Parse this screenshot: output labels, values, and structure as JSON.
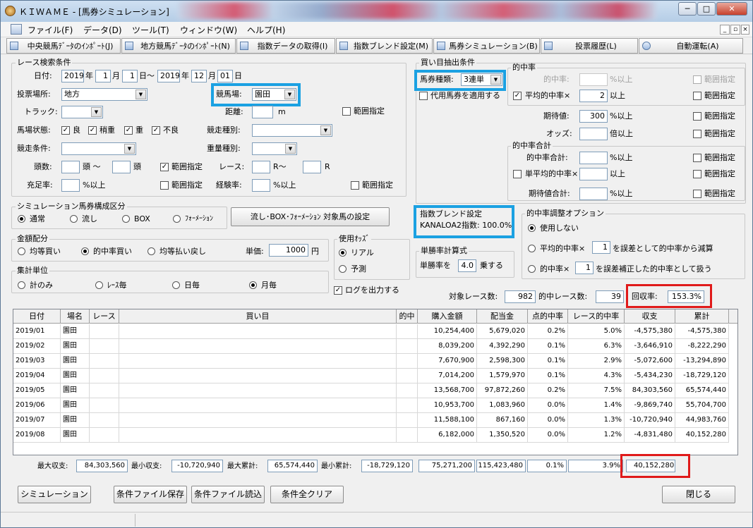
{
  "window": {
    "title": "ＫＩＷＡＭＥ - [馬券シミュレーション]",
    "minimize": "─",
    "maximize": "□",
    "close": "✕"
  },
  "menu": {
    "items": [
      "ファイル(F)",
      "データ(D)",
      "ツール(T)",
      "ウィンドウ(W)",
      "ヘルプ(H)"
    ],
    "mdi_min": "_",
    "mdi_restore": "▫",
    "mdi_close": "×"
  },
  "toolbar": {
    "items": [
      "中央競馬ﾃﾞｰﾀのｲﾝﾎﾟｰﾄ(J)",
      "地方競馬ﾃﾞｰﾀのｲﾝﾎﾟｰﾄ(N)",
      "指数データの取得(I)",
      "指数ブレンド設定(M)",
      "馬券シミュレーション(B)",
      "投票履歴(L)",
      "自動運転(A)"
    ]
  },
  "race_search": {
    "title": "レース検索条件",
    "date_label": "日付:",
    "from_year": "2019",
    "year_unit": "年",
    "from_month": "1",
    "month_unit": "月",
    "from_day": "1",
    "day_range": "日〜",
    "to_year": "2019",
    "to_month": "12",
    "to_day": "01",
    "day_unit": "日",
    "venue_label": "投票場所:",
    "venue_value": "地方",
    "track_name_label": "競馬場:",
    "track_name_value": "園田",
    "track_label": "トラック:",
    "track_value": "",
    "distance_label": "距離:",
    "distance_value": "",
    "distance_unit": "m",
    "range_label": "範囲指定",
    "condition_label": "馬場状態:",
    "conditions": [
      "良",
      "稍重",
      "重",
      "不良"
    ],
    "race_type_label": "競走種別:",
    "race_type_value": "",
    "race_cond_label": "競走条件:",
    "race_cond_value": "",
    "weight_label": "重量種別:",
    "weight_value": "",
    "heads_label": "頭数:",
    "heads_unit1": "頭 〜",
    "heads_unit2": "頭",
    "heads_range": "範囲指定",
    "race_label": "レース:",
    "race_unit1": "R〜",
    "race_unit2": "R",
    "fill_label": "充足率:",
    "fill_unit": "%以上",
    "fill_range": "範囲指定",
    "exp_label": "経験率:",
    "exp_unit": "%以上",
    "exp_range": "範囲指定"
  },
  "sim_type": {
    "title": "シミュレーション馬券構成区分",
    "options": [
      "通常",
      "流し",
      "BOX",
      "ﾌｫｰﾒｰｼｮﾝ"
    ],
    "selected": 0,
    "set_button": "流し･BOX･ﾌｫｰﾒｰｼｮﾝ 対象馬の設定"
  },
  "money": {
    "title": "金額配分",
    "options": [
      "均等買い",
      "的中率買い",
      "均等払い戻し"
    ],
    "selected": 1,
    "unit_label": "単価:",
    "unit_value": "1000",
    "unit_yen": "円"
  },
  "odds": {
    "title": "使用ｵｯｽﾞ",
    "options": [
      "リアル",
      "予測"
    ],
    "selected": 0
  },
  "aggregate": {
    "title": "集計単位",
    "options": [
      "計のみ",
      "ﾚｰｽ毎",
      "日毎",
      "月毎"
    ],
    "selected": 3
  },
  "log_label": "ログを出力する",
  "bet_extract": {
    "title": "買い目抽出条件",
    "ticket_label": "馬券種類:",
    "ticket_value": "3連単",
    "substitute_label": "代用馬券を適用する"
  },
  "hit_rate": {
    "title": "的中率",
    "rows": [
      {
        "label": "的中率:",
        "value": "",
        "unit": "%以上",
        "checked": false,
        "disabled": true
      },
      {
        "label": "平均的中率×",
        "value": "2",
        "unit": "以上",
        "checked": true
      },
      {
        "label": "期待値:",
        "value": "300",
        "unit": "%以上"
      },
      {
        "label": "オッズ:",
        "value": "",
        "unit": "倍以上"
      }
    ],
    "range_label": "範囲指定"
  },
  "hit_total": {
    "title": "的中率合計",
    "rows": [
      {
        "label": "的中率合計:",
        "value": "",
        "unit": "%以上"
      },
      {
        "label": "単平均的中率×",
        "value": "",
        "unit": "以上"
      },
      {
        "label": "期待値合計:",
        "value": "",
        "unit": "%以上"
      }
    ]
  },
  "blend": {
    "title": "指数ブレンド設定",
    "value": "KANALOA2指数: 100.0%"
  },
  "single_calc": {
    "title": "単勝率計算式",
    "label": "単勝率を",
    "value": "4.0",
    "unit": "乗する"
  },
  "adjust": {
    "title": "的中率調整オプション",
    "opt1": "使用しない",
    "opt2_pre": "平均的中率×",
    "opt2_val": "1",
    "opt2_post": "を誤差として的中率から減算",
    "opt3_pre": "的中率×",
    "opt3_val": "1",
    "opt3_post": "を誤差補正した的中率として扱う",
    "selected": 0
  },
  "summary": {
    "target_label": "対象レース数:",
    "target_value": "982",
    "hit_label": "的中レース数:",
    "hit_value": "39",
    "recovery_label": "回収率:",
    "recovery_value": "153.3%"
  },
  "table": {
    "headers": [
      "日付",
      "場名",
      "レース",
      "買い目",
      "的中",
      "購入金額",
      "配当金",
      "点的中率",
      "レース的中率",
      "収支",
      "累計"
    ],
    "rows": [
      [
        "2019/01",
        "園田",
        "",
        "",
        "",
        "10,254,400",
        "5,679,020",
        "0.2%",
        "5.0%",
        "-4,575,380",
        "-4,575,380"
      ],
      [
        "2019/02",
        "園田",
        "",
        "",
        "",
        "8,039,200",
        "4,392,290",
        "0.1%",
        "6.3%",
        "-3,646,910",
        "-8,222,290"
      ],
      [
        "2019/03",
        "園田",
        "",
        "",
        "",
        "7,670,900",
        "2,598,300",
        "0.1%",
        "2.9%",
        "-5,072,600",
        "-13,294,890"
      ],
      [
        "2019/04",
        "園田",
        "",
        "",
        "",
        "7,014,200",
        "1,579,970",
        "0.1%",
        "4.3%",
        "-5,434,230",
        "-18,729,120"
      ],
      [
        "2019/05",
        "園田",
        "",
        "",
        "",
        "13,568,700",
        "97,872,260",
        "0.2%",
        "7.5%",
        "84,303,560",
        "65,574,440"
      ],
      [
        "2019/06",
        "園田",
        "",
        "",
        "",
        "10,953,700",
        "1,083,960",
        "0.0%",
        "1.4%",
        "-9,869,740",
        "55,704,700"
      ],
      [
        "2019/07",
        "園田",
        "",
        "",
        "",
        "11,588,100",
        "867,160",
        "0.0%",
        "1.3%",
        "-10,720,940",
        "44,983,760"
      ],
      [
        "2019/08",
        "園田",
        "",
        "",
        "",
        "6,182,000",
        "1,350,520",
        "0.0%",
        "1.2%",
        "-4,831,480",
        "40,152,280"
      ]
    ]
  },
  "totals": {
    "max_income_label": "最大収支:",
    "max_income": "84,303,560",
    "min_income_label": "最小収支:",
    "min_income": "-10,720,940",
    "max_cum_label": "最大累計:",
    "max_cum": "65,574,440",
    "min_cum_label": "最小累計:",
    "min_cum": "-18,729,120",
    "purchase": "75,271,200",
    "payout": "115,423,480",
    "point_rate": "0.1%",
    "race_rate": "3.9%",
    "cumulative": "40,152,280"
  },
  "buttons": {
    "simulate": "シミュレーション",
    "save": "条件ファイル保存",
    "load": "条件ファイル読込",
    "clear": "条件全クリア",
    "close": "閉じる"
  }
}
